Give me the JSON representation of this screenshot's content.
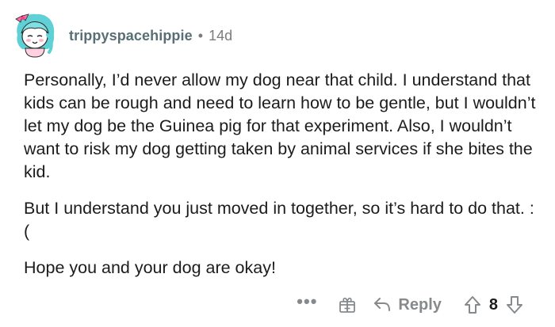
{
  "comment": {
    "author": "trippyspacehippie",
    "separator": "•",
    "age": "14d",
    "paragraphs": [
      "Personally, I’d never allow my dog near that child. I understand that kids can be rough and need to learn how to be gentle, but I wouldn’t let my dog be the Guinea pig for that experiment. Also, I wouldn’t want to risk my dog getting taken by animal services if she bites the kid.",
      "But I understand you just moved in together, so it’s hard to do that. :(",
      "Hope you and your dog are okay!"
    ]
  },
  "actions": {
    "more_label": "•••",
    "reply_label": "Reply",
    "vote_count": "8"
  },
  "colors": {
    "author": "#576f76",
    "meta": "#7c7c7c",
    "action": "#878a8c",
    "text": "#1c1c1c",
    "avatar_hair": "#5ed0d6",
    "avatar_bow": "#ff6fa6"
  },
  "icons": {
    "avatar": "snoo-avatar-cyan-hair",
    "award": "award-gift-icon",
    "reply": "reply-arrow-icon",
    "upvote": "upvote-arrow-icon",
    "downvote": "downvote-arrow-icon"
  }
}
